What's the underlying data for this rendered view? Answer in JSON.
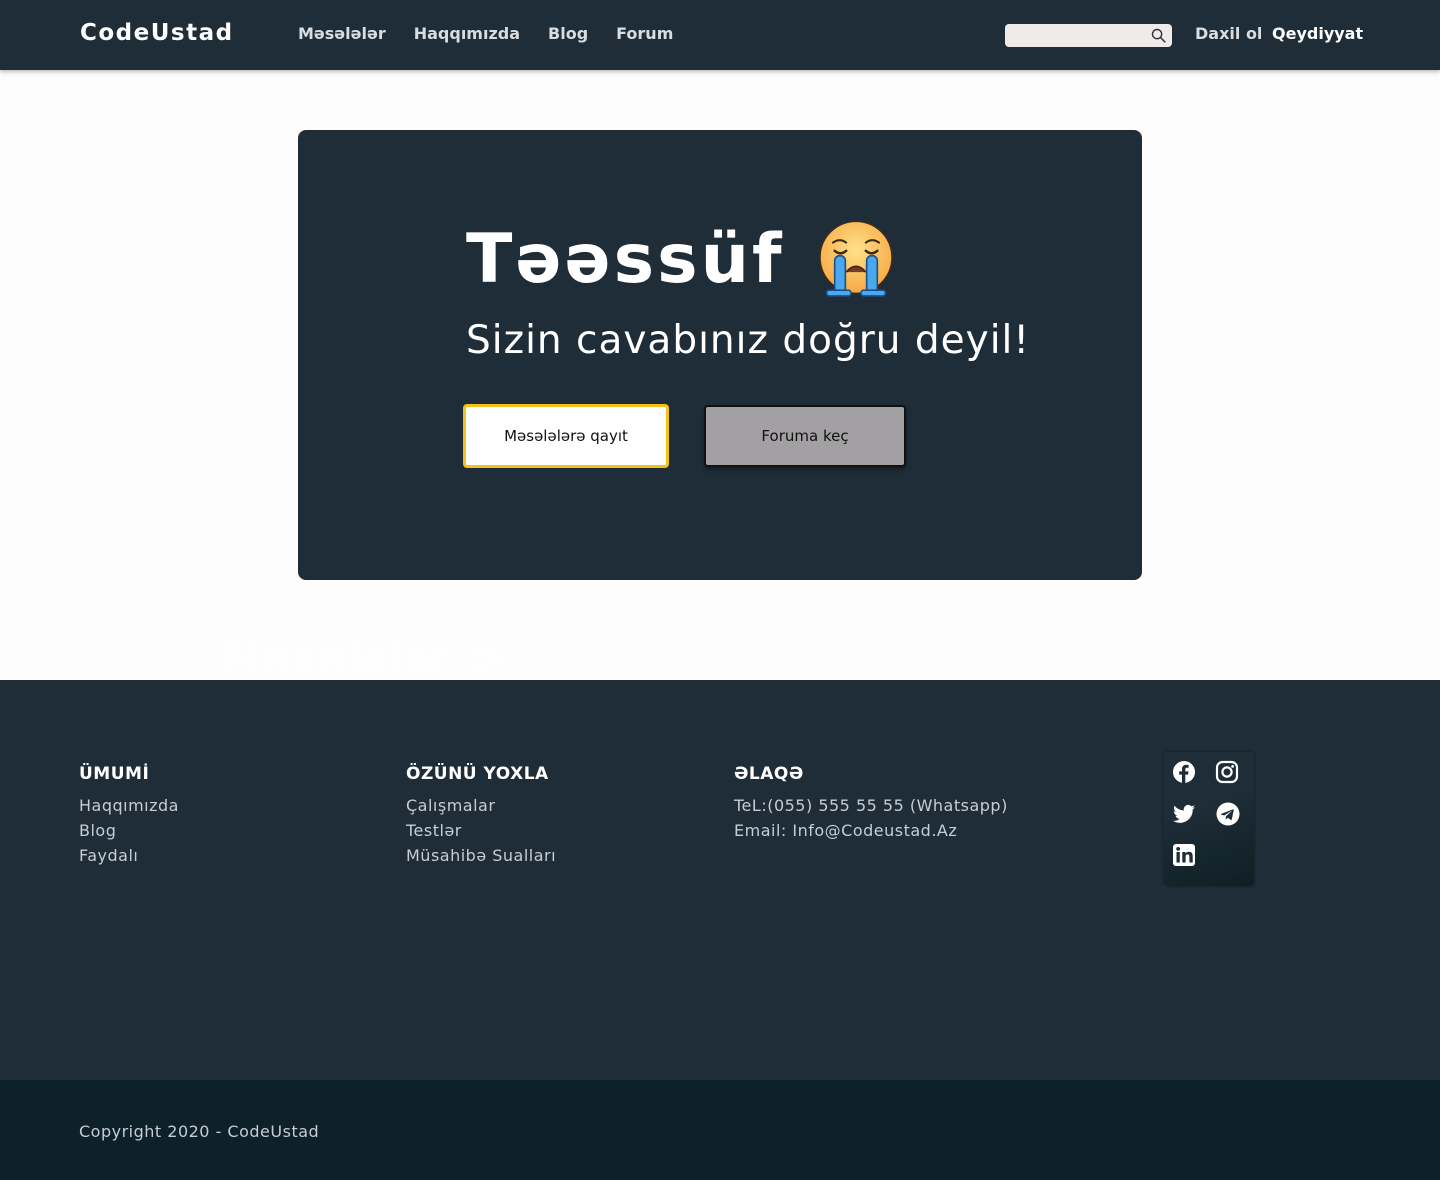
{
  "nav": {
    "logo": "CodeUstad",
    "links": [
      "Məsələlər",
      "Haqqımızda",
      "Blog",
      "Forum"
    ],
    "search_placeholder": "",
    "login": "Daxil ol",
    "register": "Qeydiyyat"
  },
  "card": {
    "title": "Təəssüf",
    "emoji": "loudly-crying-face-icon",
    "subtitle": "Sizin cavabınız doğru deyil!",
    "back_button": "Məsələlərə qayıt",
    "forum_button": "Foruma keç"
  },
  "faint_label": "Məsələlər >",
  "footer": {
    "col1": {
      "title": "ÜMUMİ",
      "links": [
        "Haqqımızda",
        "Blog",
        "Faydalı"
      ]
    },
    "col2": {
      "title": "ÖZÜNÜ YOXLA",
      "links": [
        "Çalışmalar",
        "Testlər",
        "Müsahibə Sualları"
      ]
    },
    "col3": {
      "title": "ƏLAQƏ",
      "lines": [
        "TeL:(055) 555 55 55 (Whatsapp)",
        "Email: Info@Codeustad.Az"
      ]
    },
    "social": [
      "facebook-icon",
      "instagram-icon",
      "twitter-icon",
      "telegram-icon",
      "linkedin-icon"
    ]
  },
  "copyright": "Copyright 2020 - CodeUstad",
  "colors": {
    "dark": "#1e2d37",
    "darker": "#0e212a",
    "accent": "#f2c21b",
    "button_gray": "#a3a0a3"
  }
}
